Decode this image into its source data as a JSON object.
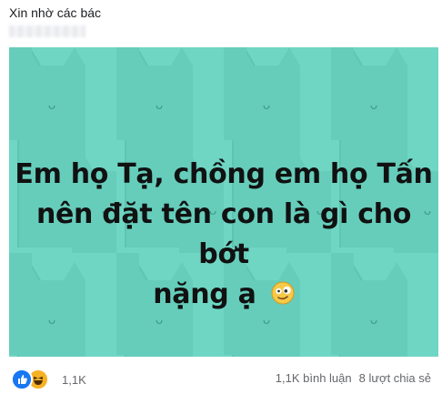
{
  "post": {
    "caption": "Xin nhờ các bác"
  },
  "image": {
    "background_color": "#6fd6c4",
    "pattern_color": "#63cbb9",
    "headline_lines": [
      "Em họ Tạ, chồng em họ Tấn",
      "nên đặt tên con là gì cho bớt",
      "nặng ạ"
    ],
    "emoji": "zany-face-icon"
  },
  "footer": {
    "reaction_icons": [
      "like-icon",
      "haha-icon"
    ],
    "reaction_count": "1,1K",
    "comments": "1,1K bình luận",
    "shares": "8 lượt chia sẻ"
  }
}
